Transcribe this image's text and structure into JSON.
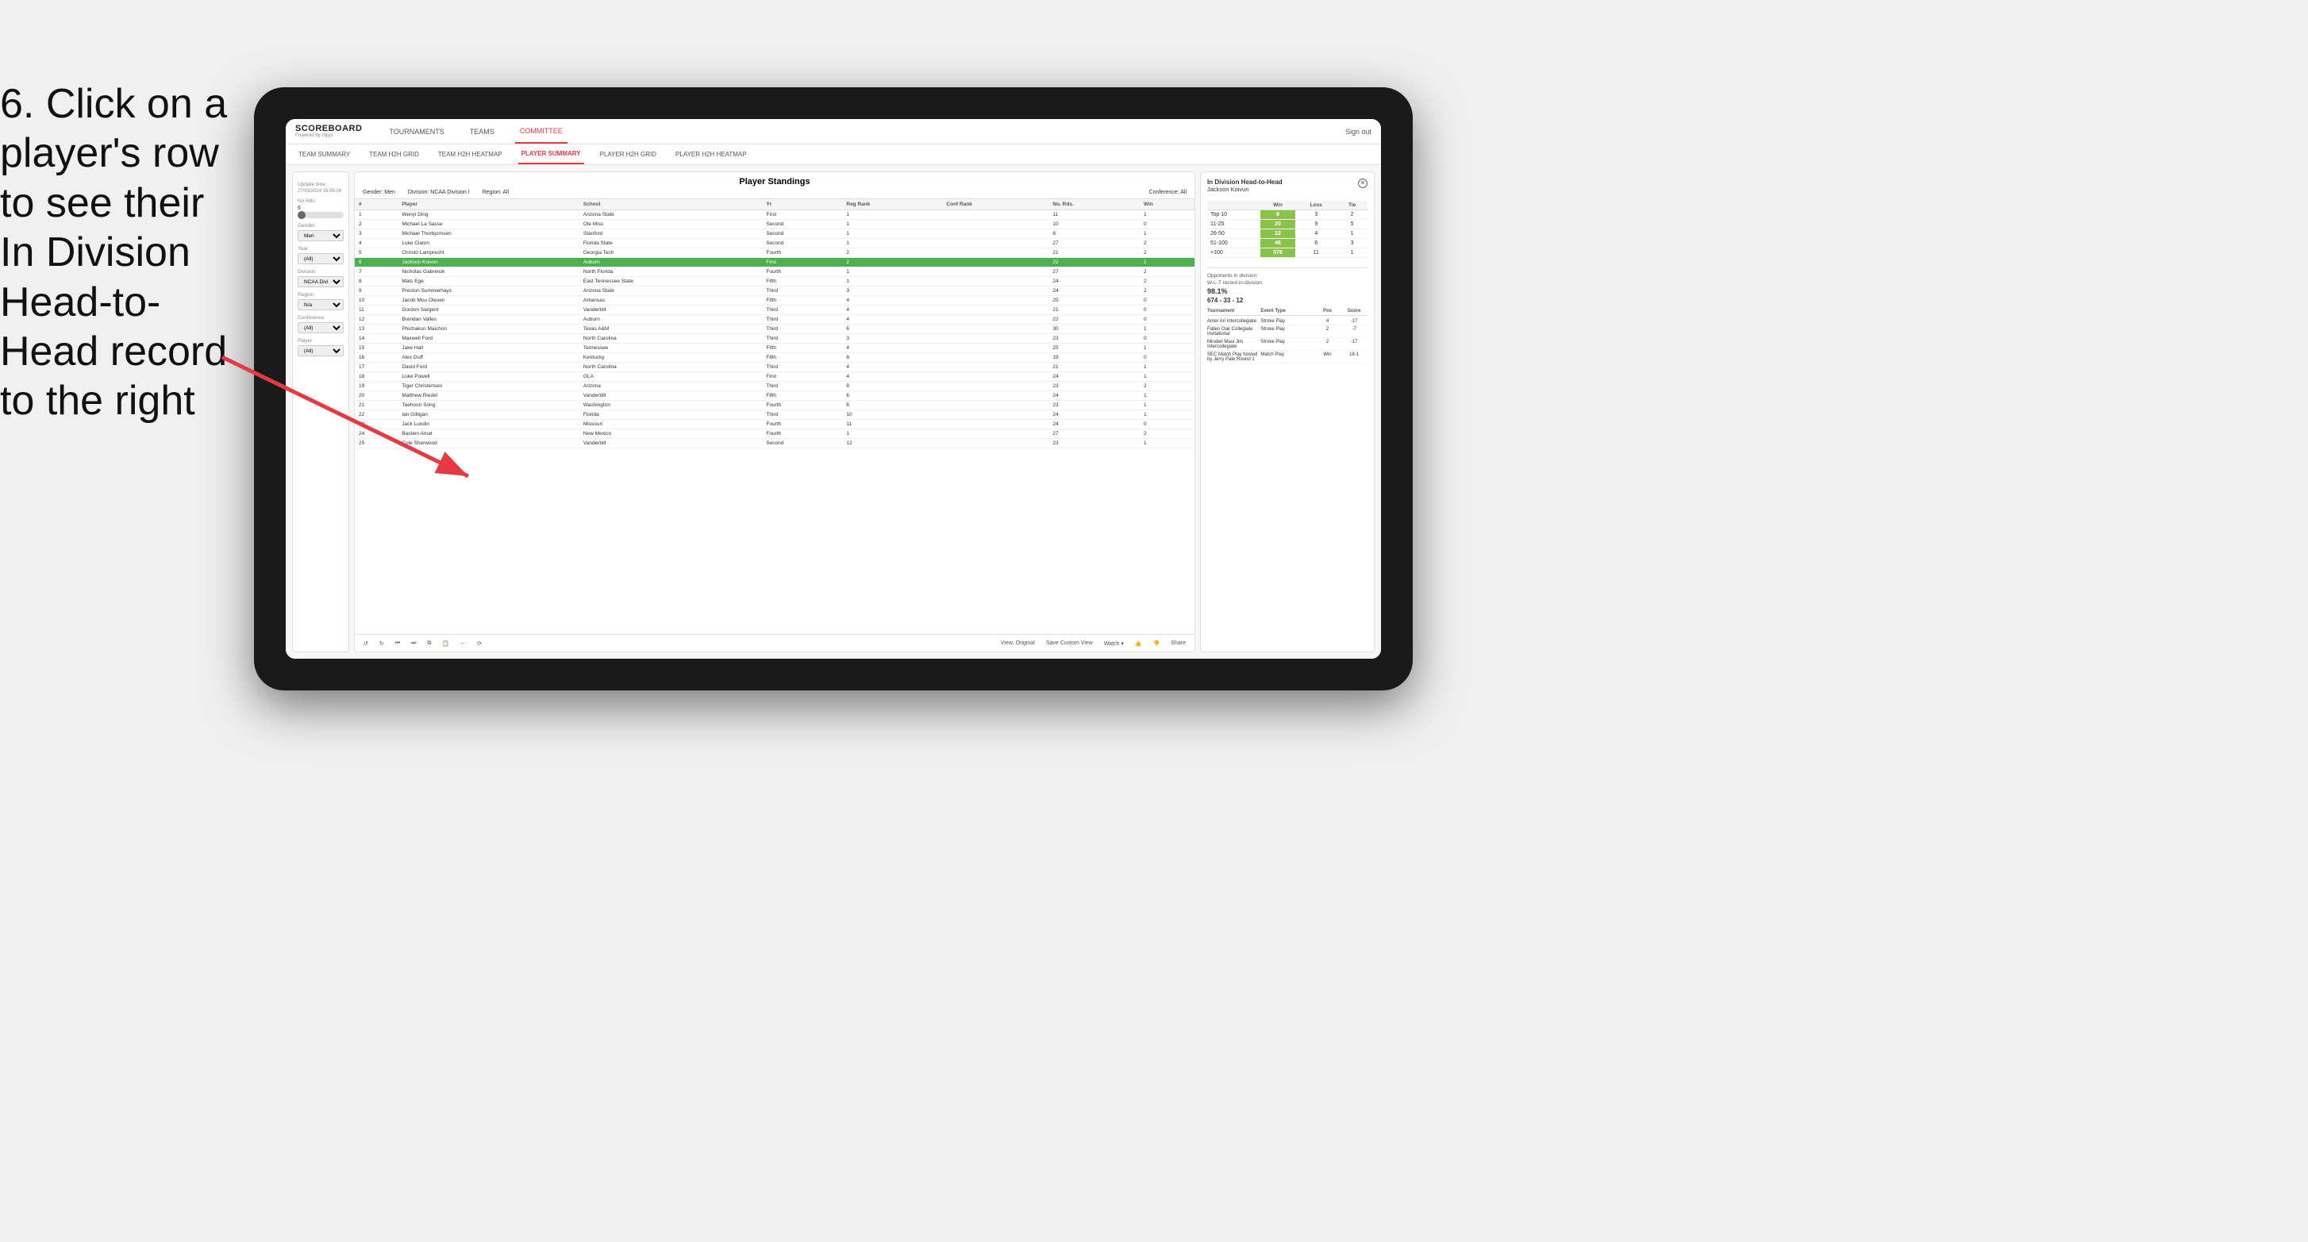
{
  "instruction": {
    "text": "6. Click on a player's row to see their In Division Head-to-Head record to the right"
  },
  "nav": {
    "logo": "SCOREBOARD",
    "powered_by": "Powered by clippi",
    "items": [
      "TOURNAMENTS",
      "TEAMS",
      "COMMITTEE"
    ],
    "active_item": "COMMITTEE",
    "sign_out": "Sign out"
  },
  "sub_nav": {
    "items": [
      "TEAM SUMMARY",
      "TEAM H2H GRID",
      "TEAM H2H HEATMAP",
      "PLAYER SUMMARY",
      "PLAYER H2H GRID",
      "PLAYER H2H HEATMAP"
    ],
    "active_item": "PLAYER SUMMARY"
  },
  "filters": {
    "update_label": "Update time:",
    "update_time": "27/03/2024 16:56:26",
    "no_rds_label": "No Rds.",
    "no_rds_value": "6",
    "gender_label": "Gender",
    "gender_value": "Men",
    "year_label": "Year",
    "year_value": "(All)",
    "division_label": "Division",
    "division_value": "NCAA Division I",
    "region_label": "Region",
    "region_value": "N/a",
    "conference_label": "Conference",
    "conference_value": "(All)",
    "player_label": "Player",
    "player_value": "(All)"
  },
  "standings": {
    "title": "Player Standings",
    "gender_label": "Gender:",
    "gender": "Men",
    "division_label": "Division:",
    "division": "NCAA Division I",
    "region_label": "Region:",
    "region": "All",
    "conference_label": "Conference:",
    "conference": "All",
    "columns": [
      "#",
      "Player",
      "School",
      "Yr",
      "Reg Rank",
      "Conf Rank",
      "No. Rds.",
      "Win"
    ],
    "rows": [
      {
        "rank": 1,
        "player": "Wenyi Ding",
        "school": "Arizona State",
        "yr": "First",
        "reg_rank": 1,
        "conf_rank": "",
        "no_rds": 11,
        "win": 1
      },
      {
        "rank": 2,
        "player": "Michael La Sasse",
        "school": "Ole Miss",
        "yr": "Second",
        "reg_rank": 1,
        "conf_rank": "",
        "no_rds": 10,
        "win": 0
      },
      {
        "rank": 3,
        "player": "Michael Thorbjornsen",
        "school": "Stanford",
        "yr": "Second",
        "reg_rank": 1,
        "conf_rank": "",
        "no_rds": 8,
        "win": 1
      },
      {
        "rank": 4,
        "player": "Luke Claton",
        "school": "Florida State",
        "yr": "Second",
        "reg_rank": 1,
        "conf_rank": "",
        "no_rds": 27,
        "win": 2
      },
      {
        "rank": 5,
        "player": "Christo Lamprecht",
        "school": "Georgia Tech",
        "yr": "Fourth",
        "reg_rank": 2,
        "conf_rank": "",
        "no_rds": 21,
        "win": 2
      },
      {
        "rank": 6,
        "player": "Jackson Koivun",
        "school": "Auburn",
        "yr": "First",
        "reg_rank": 2,
        "conf_rank": "",
        "no_rds": 22,
        "win": 1,
        "selected": true
      },
      {
        "rank": 7,
        "player": "Nicholas Gabrelcik",
        "school": "North Florida",
        "yr": "Fourth",
        "reg_rank": 1,
        "conf_rank": "",
        "no_rds": 27,
        "win": 2
      },
      {
        "rank": 8,
        "player": "Mats Ege",
        "school": "East Tennessee State",
        "yr": "Fifth",
        "reg_rank": 1,
        "conf_rank": "",
        "no_rds": 24,
        "win": 2
      },
      {
        "rank": 9,
        "player": "Preston Summerhays",
        "school": "Arizona State",
        "yr": "Third",
        "reg_rank": 3,
        "conf_rank": "",
        "no_rds": 24,
        "win": 2
      },
      {
        "rank": 10,
        "player": "Jacob Mou Olesen",
        "school": "Arkansas",
        "yr": "Fifth",
        "reg_rank": 4,
        "conf_rank": "",
        "no_rds": 25,
        "win": 0
      },
      {
        "rank": 11,
        "player": "Gordon Sargent",
        "school": "Vanderbilt",
        "yr": "Third",
        "reg_rank": 4,
        "conf_rank": "",
        "no_rds": 21,
        "win": 0
      },
      {
        "rank": 12,
        "player": "Brendan Valles",
        "school": "Auburn",
        "yr": "Third",
        "reg_rank": 4,
        "conf_rank": "",
        "no_rds": 22,
        "win": 0
      },
      {
        "rank": 13,
        "player": "Phichakun Maichon",
        "school": "Texas A&M",
        "yr": "Third",
        "reg_rank": 6,
        "conf_rank": "",
        "no_rds": 30,
        "win": 1
      },
      {
        "rank": 14,
        "player": "Maxwell Ford",
        "school": "North Carolina",
        "yr": "Third",
        "reg_rank": 3,
        "conf_rank": "",
        "no_rds": 23,
        "win": 0
      },
      {
        "rank": 15,
        "player": "Jake Hall",
        "school": "Tennessee",
        "yr": "Fifth",
        "reg_rank": 4,
        "conf_rank": "",
        "no_rds": 25,
        "win": 1
      },
      {
        "rank": 16,
        "player": "Alex Goff",
        "school": "Kentucky",
        "yr": "Fifth",
        "reg_rank": 8,
        "conf_rank": "",
        "no_rds": 19,
        "win": 0
      },
      {
        "rank": 17,
        "player": "David Ford",
        "school": "North Carolina",
        "yr": "Third",
        "reg_rank": 4,
        "conf_rank": "",
        "no_rds": 21,
        "win": 1
      },
      {
        "rank": 18,
        "player": "Luke Powell",
        "school": "GLA",
        "yr": "First",
        "reg_rank": 4,
        "conf_rank": "",
        "no_rds": 24,
        "win": 1
      },
      {
        "rank": 19,
        "player": "Tiger Christensen",
        "school": "Arizona",
        "yr": "Third",
        "reg_rank": 8,
        "conf_rank": "",
        "no_rds": 23,
        "win": 2
      },
      {
        "rank": 20,
        "player": "Matthew Riedel",
        "school": "Vanderbilt",
        "yr": "Fifth",
        "reg_rank": 6,
        "conf_rank": "",
        "no_rds": 24,
        "win": 1
      },
      {
        "rank": 21,
        "player": "Taehoon Song",
        "school": "Washington",
        "yr": "Fourth",
        "reg_rank": 6,
        "conf_rank": "",
        "no_rds": 23,
        "win": 1
      },
      {
        "rank": 22,
        "player": "Ian Gilligan",
        "school": "Florida",
        "yr": "Third",
        "reg_rank": 10,
        "conf_rank": "",
        "no_rds": 24,
        "win": 1
      },
      {
        "rank": 23,
        "player": "Jack Lundin",
        "school": "Missouri",
        "yr": "Fourth",
        "reg_rank": 11,
        "conf_rank": "",
        "no_rds": 24,
        "win": 0
      },
      {
        "rank": 24,
        "player": "Bastien Amat",
        "school": "New Mexico",
        "yr": "Fourth",
        "reg_rank": 1,
        "conf_rank": "",
        "no_rds": 27,
        "win": 2
      },
      {
        "rank": 25,
        "player": "Cole Sherwood",
        "school": "Vanderbilt",
        "yr": "Second",
        "reg_rank": 12,
        "conf_rank": "",
        "no_rds": 23,
        "win": 1
      }
    ]
  },
  "toolbar": {
    "undo": "↺",
    "redo": "↻",
    "view_original": "View: Original",
    "save_custom": "Save Custom View",
    "watch": "Watch ▾",
    "share": "Share"
  },
  "h2h": {
    "title": "In Division Head-to-Head",
    "player_name": "Jackson Koivun",
    "columns": [
      "",
      "Win",
      "Loss",
      "Tie"
    ],
    "rows": [
      {
        "range": "Top 10",
        "win": 8,
        "loss": 3,
        "tie": 2
      },
      {
        "range": "11-25",
        "win": 20,
        "loss": 9,
        "tie": 5
      },
      {
        "range": "26-50",
        "win": 22,
        "loss": 4,
        "tie": 1
      },
      {
        "range": "51-100",
        "win": 46,
        "loss": 6,
        "tie": 3
      },
      {
        "range": ">100",
        "win": 578,
        "loss": 11,
        "tie": 1
      }
    ],
    "opponents_label": "Opponents in division:",
    "wlt_label": "W-L-T record in-division:",
    "win_pct": "98.1%",
    "record": "674 - 33 - 12",
    "tournament_columns": [
      "Tournament",
      "Event Type",
      "Pos",
      "Score"
    ],
    "tournaments": [
      {
        "name": "Amer Ari Intercollegiate",
        "type": "Stroke Play",
        "pos": 4,
        "score": "-17"
      },
      {
        "name": "Fallen Oak Collegiate Invitational",
        "type": "Stroke Play",
        "pos": 2,
        "score": "-7"
      },
      {
        "name": "Mirabel Maui Jim Intercollegiate",
        "type": "Stroke Play",
        "pos": 2,
        "score": "-17"
      },
      {
        "name": "SEC Match Play hosted by Jerry Pate Round 1",
        "type": "Match Play",
        "pos": "Win",
        "score": "18-1"
      }
    ]
  }
}
